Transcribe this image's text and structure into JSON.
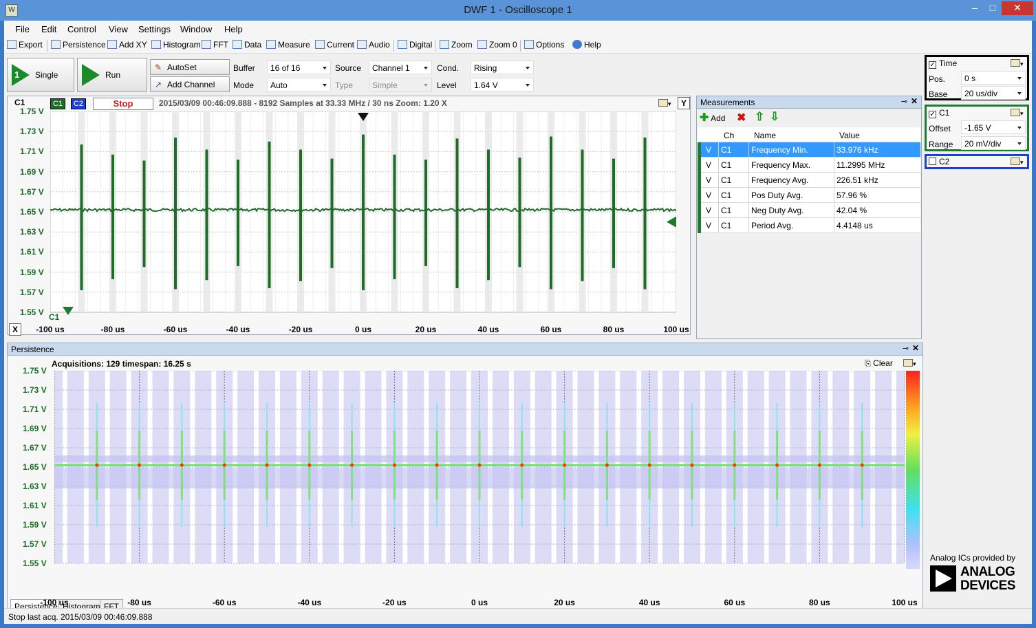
{
  "window": {
    "title": "DWF 1 - Oscilloscope 1",
    "logo_text": "W",
    "minimize": "–",
    "maximize": "□",
    "close": "✕"
  },
  "menu": [
    "File",
    "Edit",
    "Control",
    "View",
    "Settings",
    "Window",
    "Help"
  ],
  "toolbar": [
    "Export",
    "Persistence",
    "Add XY",
    "Histogram",
    "FFT",
    "Data",
    "Measure",
    "Current",
    "Audio",
    "Digital",
    "Zoom",
    "Zoom 0",
    "Options",
    "Help"
  ],
  "controls": {
    "single": "Single",
    "single_digit": "1",
    "run": "Run",
    "autoset": "AutoSet",
    "add_channel": "Add Channel",
    "buffer_label": "Buffer",
    "buffer_value": "16 of 16",
    "mode_label": "Mode",
    "mode_value": "Auto",
    "source_label": "Source",
    "source_value": "Channel 1",
    "type_label": "Type",
    "type_value": "Simple",
    "cond_label": "Cond.",
    "cond_value": "Rising",
    "level_label": "Level",
    "level_value": "1.64 V"
  },
  "scope": {
    "ch_label": "C1",
    "c1_badge": "C1",
    "c2_badge": "C2",
    "state": "Stop",
    "info": "2015/03/09 00:46:09.888 - 8192 Samples at 33.33 MHz / 30 ns Zoom: 1.20 X",
    "y_button": "Y",
    "x_button": "X",
    "trigger_marker_label": "C1",
    "y_labels": [
      "1.75 V",
      "1.73 V",
      "1.71 V",
      "1.69 V",
      "1.67 V",
      "1.65 V",
      "1.63 V",
      "1.61 V",
      "1.59 V",
      "1.57 V",
      "1.55 V"
    ],
    "x_labels": [
      "-100 us",
      "-80 us",
      "-60 us",
      "-40 us",
      "-20 us",
      "0 us",
      "20 us",
      "40 us",
      "60 us",
      "80 us",
      "100 us"
    ],
    "trace_color": "#1e6b2a"
  },
  "chart_data": [
    {
      "type": "line",
      "title": "",
      "xlabel": "",
      "ylabel": "",
      "xlim": [
        -100,
        100
      ],
      "ylim": [
        1.55,
        1.75
      ],
      "x_unit": "us",
      "y_unit": "V",
      "series": [
        {
          "values": "baseline ~1.652 V with narrow spikes"
        }
      ],
      "baseline": 1.652,
      "spikes": [
        {
          "x": -90,
          "hi": 1.717,
          "lo": 1.572
        },
        {
          "x": -80,
          "hi": 1.707,
          "lo": 1.583
        },
        {
          "x": -70,
          "hi": 1.701,
          "lo": 1.595
        },
        {
          "x": -60,
          "hi": 1.724,
          "lo": 1.573
        },
        {
          "x": -50,
          "hi": 1.712,
          "lo": 1.582
        },
        {
          "x": -40,
          "hi": 1.702,
          "lo": 1.596
        },
        {
          "x": -30,
          "hi": 1.72,
          "lo": 1.574
        },
        {
          "x": -20,
          "hi": 1.712,
          "lo": 1.581
        },
        {
          "x": -10,
          "hi": 1.703,
          "lo": 1.594
        },
        {
          "x": 0,
          "hi": 1.727,
          "lo": 1.572
        },
        {
          "x": 10,
          "hi": 1.707,
          "lo": 1.583
        },
        {
          "x": 20,
          "hi": 1.702,
          "lo": 1.596
        },
        {
          "x": 30,
          "hi": 1.723,
          "lo": 1.574
        },
        {
          "x": 40,
          "hi": 1.712,
          "lo": 1.582
        },
        {
          "x": 50,
          "hi": 1.704,
          "lo": 1.595
        },
        {
          "x": 60,
          "hi": 1.725,
          "lo": 1.573
        },
        {
          "x": 70,
          "hi": 1.712,
          "lo": 1.581
        },
        {
          "x": 80,
          "hi": 1.703,
          "lo": 1.594
        },
        {
          "x": 90,
          "hi": 1.724,
          "lo": 1.573
        }
      ]
    },
    {
      "type": "heatmap",
      "title": "Acquisitions: 129 timespan: 16.25 s",
      "xlim": [
        -100,
        100
      ],
      "ylim": [
        1.55,
        1.75
      ],
      "baseline": 1.652,
      "spike_x": [
        -90,
        -80,
        -70,
        -60,
        -50,
        -40,
        -30,
        -20,
        -10,
        0,
        10,
        20,
        30,
        40,
        50,
        60,
        70,
        80,
        90
      ]
    }
  ],
  "measurements": {
    "title": "Measurements",
    "add": "Add",
    "columns": [
      "Ch",
      "Name",
      "Value"
    ],
    "rows": [
      {
        "type": "V",
        "ch": "C1",
        "name": "Frequency Min.",
        "value": "33.976 kHz"
      },
      {
        "type": "V",
        "ch": "C1",
        "name": "Frequency Max.",
        "value": "11.2995 MHz"
      },
      {
        "type": "V",
        "ch": "C1",
        "name": "Frequency Avg.",
        "value": "226.51 kHz"
      },
      {
        "type": "V",
        "ch": "C1",
        "name": "Pos Duty Avg.",
        "value": "57.96 %"
      },
      {
        "type": "V",
        "ch": "C1",
        "name": "Neg Duty Avg.",
        "value": "42.04 %"
      },
      {
        "type": "V",
        "ch": "C1",
        "name": "Period Avg.",
        "value": "4.4148 us"
      }
    ]
  },
  "persistence": {
    "title": "Persistence",
    "acq": "Acquisitions: 129 timespan: 16.25 s",
    "clear": "Clear",
    "y_labels": [
      "1.75 V",
      "1.73 V",
      "1.71 V",
      "1.69 V",
      "1.67 V",
      "1.65 V",
      "1.63 V",
      "1.61 V",
      "1.59 V",
      "1.57 V",
      "1.55 V"
    ],
    "x_labels": [
      "-100 us",
      "-80 us",
      "-60 us",
      "-40 us",
      "-20 us",
      "0 us",
      "20 us",
      "40 us",
      "60 us",
      "80 us",
      "100 us"
    ],
    "tabs": [
      "Persistence",
      "Histogram",
      "FFT"
    ]
  },
  "right": {
    "time": {
      "title": "Time",
      "pos_label": "Pos.",
      "pos_value": "0 s",
      "base_label": "Base",
      "base_value": "20 us/div"
    },
    "c1": {
      "title": "C1",
      "offset_label": "Offset",
      "offset_value": "-1.65 V",
      "range_label": "Range",
      "range_value": "20 mV/div"
    },
    "c2": {
      "title": "C2"
    },
    "brand_caption": "Analog ICs provided by",
    "brand_name_1": "ANALOG",
    "brand_name_2": "DEVICES"
  },
  "status": "Stop last acq. 2015/03/09  00:46:09.888"
}
